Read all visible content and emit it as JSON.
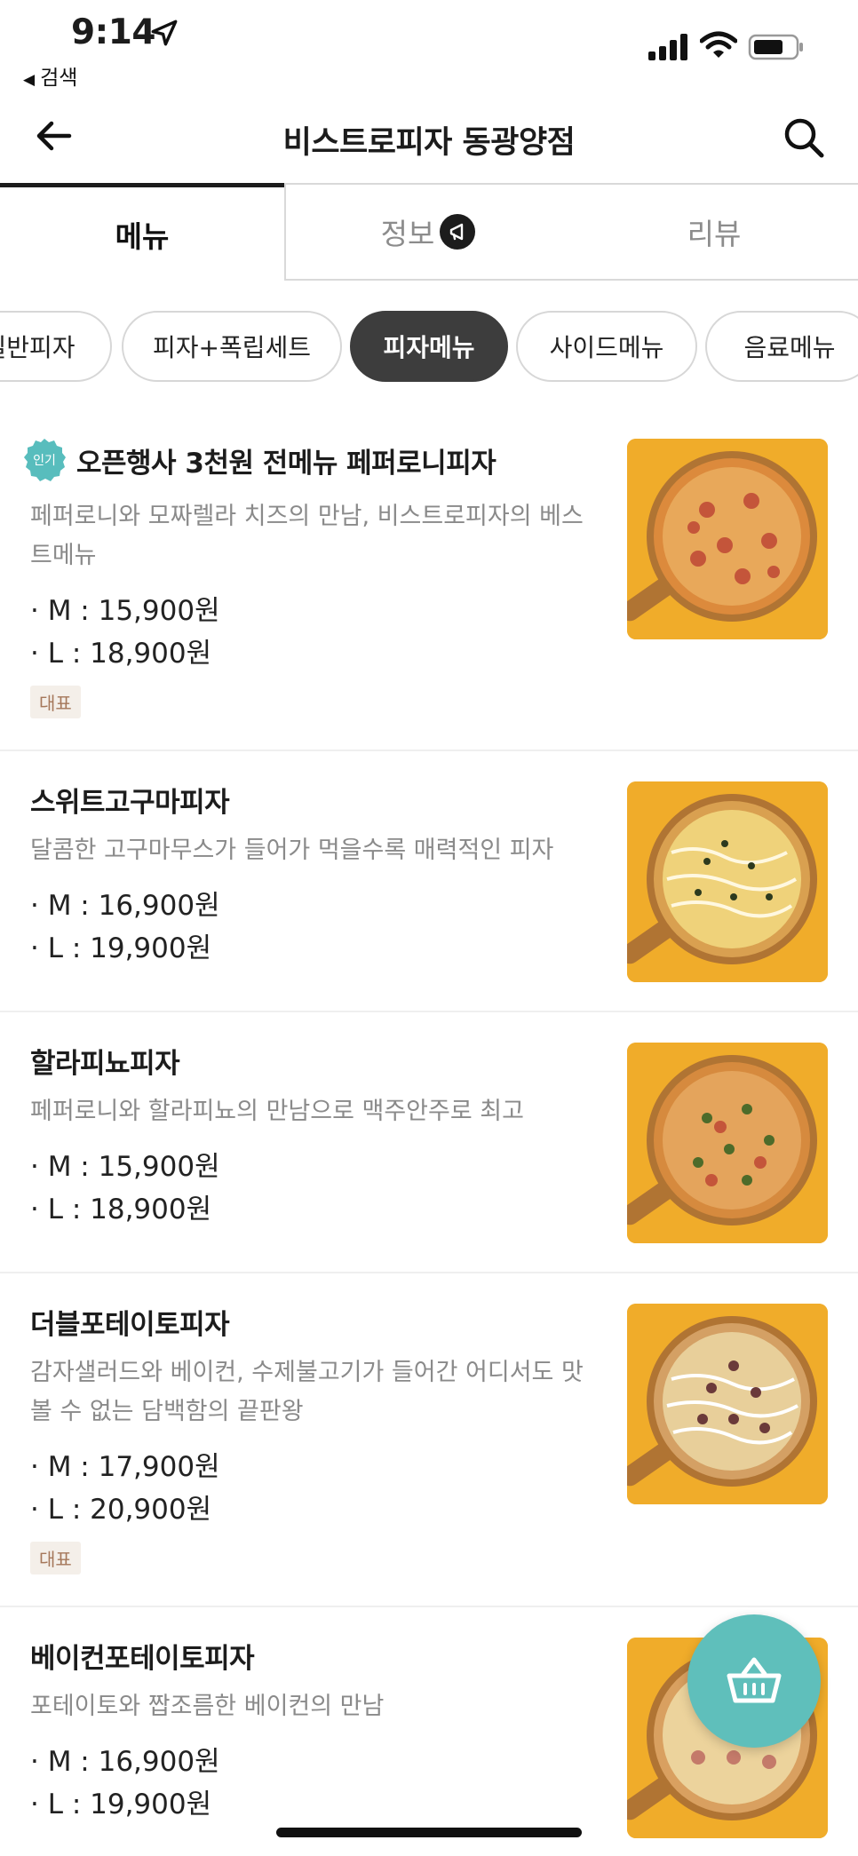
{
  "status_bar": {
    "time": "9:14",
    "back_app_label": "검색"
  },
  "header": {
    "title": "비스트로피자 동광양점"
  },
  "tabs": [
    {
      "label": "메뉴"
    },
    {
      "label": "정보"
    },
    {
      "label": "리뷰"
    }
  ],
  "categories": [
    {
      "label": "일반피자"
    },
    {
      "label": "피자+폭립세트"
    },
    {
      "label": "피자메뉴"
    },
    {
      "label": "사이드메뉴"
    },
    {
      "label": "음료메뉴"
    }
  ],
  "popular_badge": "인기",
  "menu_items": [
    {
      "name": "오픈행사 3천원 전메뉴 페퍼로니피자",
      "description": "페퍼로니와 모짜렐라 치즈의 만남, 비스트로피자의 베스트메뉴",
      "price_m": "· M : 15,900원",
      "price_l": "· L : 18,900원",
      "tag": "대표"
    },
    {
      "name": "스위트고구마피자",
      "description": "달콤한 고구마무스가 들어가 먹을수록 매력적인 피자",
      "price_m": "· M : 16,900원",
      "price_l": "· L : 19,900원"
    },
    {
      "name": "할라피뇨피자",
      "description": "페퍼로니와 할라피뇨의 만남으로 맥주안주로 최고",
      "price_m": "· M : 15,900원",
      "price_l": "· L : 18,900원"
    },
    {
      "name": "더블포테이토피자",
      "description": "감자샐러드와 베이컨, 수제불고기가 들어간 어디서도 맛볼 수 없는 담백함의 끝판왕",
      "price_m": "· M : 17,900원",
      "price_l": "· L : 20,900원",
      "tag": "대표"
    },
    {
      "name": "베이컨포테이토피자",
      "description": "포테이토와 짭조름한 베이컨의 만남",
      "price_m": "· M : 16,900원",
      "price_l": "· L : 19,900원"
    }
  ],
  "colors": {
    "accent_teal": "#5fbfbb",
    "active_chip": "#3d3d3d",
    "tag_bg": "#f4efe9",
    "tag_text": "#a5775a",
    "image_bg": "#f0ac2a"
  },
  "icons": {
    "back": "arrow-left-icon",
    "search": "search-icon",
    "info_badge": "megaphone-icon",
    "cart": "basket-icon",
    "popular": "popular-badge-icon"
  }
}
